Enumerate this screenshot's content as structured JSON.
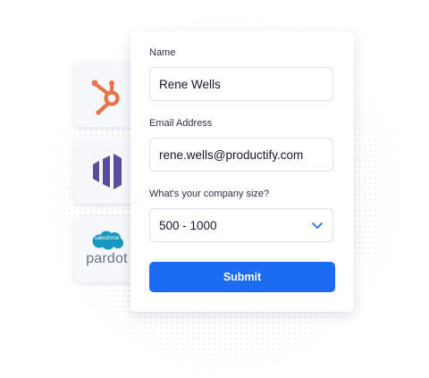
{
  "integrations": {
    "hubspot": {
      "icon": "hubspot-logo",
      "color": "#e8734b"
    },
    "marketo": {
      "icon": "marketo-logo",
      "color": "#5c4c9f"
    },
    "pardot": {
      "icon": "salesforce-pardot-logo",
      "cloud_text": "salesforce",
      "name": "pardot",
      "cloud_color": "#1798c1"
    }
  },
  "form": {
    "name_label": "Name",
    "name_value": "Rene Wells",
    "email_label": "Email Address",
    "email_value": "rene.wells@productify.com",
    "company_size_label": "What's your company size?",
    "company_size_value": "500 - 1000",
    "submit_label": "Submit",
    "accent_color": "#1b6cf2"
  }
}
